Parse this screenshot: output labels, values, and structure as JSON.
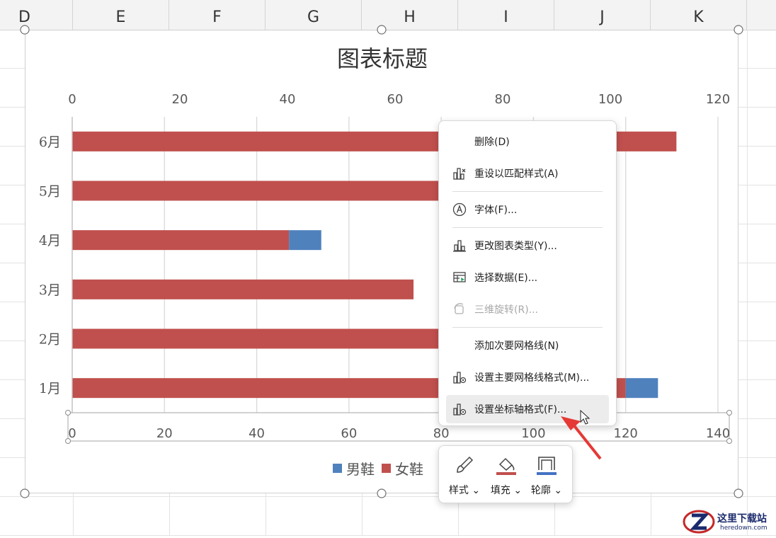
{
  "spreadsheet": {
    "columns": [
      "D",
      "E",
      "F",
      "G",
      "H",
      "I",
      "J",
      "K"
    ]
  },
  "chart_data": {
    "type": "bar",
    "orientation": "horizontal",
    "stacked": true,
    "title": "图表标题",
    "categories": [
      "1月",
      "2月",
      "3月",
      "4月",
      "5月",
      "6月"
    ],
    "series": [
      {
        "name": "女鞋",
        "color": "#c0504d",
        "values": [
          120,
          107,
          74,
          47,
          103,
          131
        ]
      },
      {
        "name": "男鞋",
        "color": "#4f81bd",
        "values": [
          7,
          0,
          0,
          7,
          0,
          0
        ]
      }
    ],
    "primary_axis": {
      "min": 0,
      "max": 140,
      "ticks": [
        "0",
        "20",
        "40",
        "60",
        "80",
        "100",
        "120",
        "140"
      ]
    },
    "secondary_axis": {
      "min": 0,
      "max": 120,
      "ticks": [
        "0",
        "20",
        "40",
        "60",
        "80",
        "100",
        "120"
      ]
    },
    "grid": true,
    "legend_position": "bottom",
    "legend": [
      "男鞋",
      "女鞋"
    ]
  },
  "context_menu": {
    "items": [
      {
        "label": "删除(D)",
        "icon": "none",
        "disabled": false
      },
      {
        "label": "重设以匹配样式(A)",
        "icon": "reset-style-icon",
        "disabled": false
      },
      {
        "label": "字体(F)...",
        "icon": "font-icon",
        "disabled": false
      },
      {
        "label": "更改图表类型(Y)...",
        "icon": "chart-type-icon",
        "disabled": false
      },
      {
        "label": "选择数据(E)...",
        "icon": "select-data-icon",
        "disabled": false
      },
      {
        "label": "三维旋转(R)...",
        "icon": "3d-rotate-icon",
        "disabled": true
      },
      {
        "label": "添加次要网格线(N)",
        "icon": "none",
        "disabled": false
      },
      {
        "label": "设置主要网格线格式(M)...",
        "icon": "format-gridlines-icon",
        "disabled": false
      },
      {
        "label": "设置坐标轴格式(F)...",
        "icon": "format-axis-icon",
        "disabled": false,
        "hovered": true
      }
    ]
  },
  "mini_toolbar": {
    "style_label": "样式",
    "fill_label": "填充",
    "outline_label": "轮廓",
    "fill_color": "#c0504d",
    "outline_color": "#4472c4"
  },
  "watermark": {
    "text": "这里下载站",
    "url_text": "heredown.com"
  }
}
